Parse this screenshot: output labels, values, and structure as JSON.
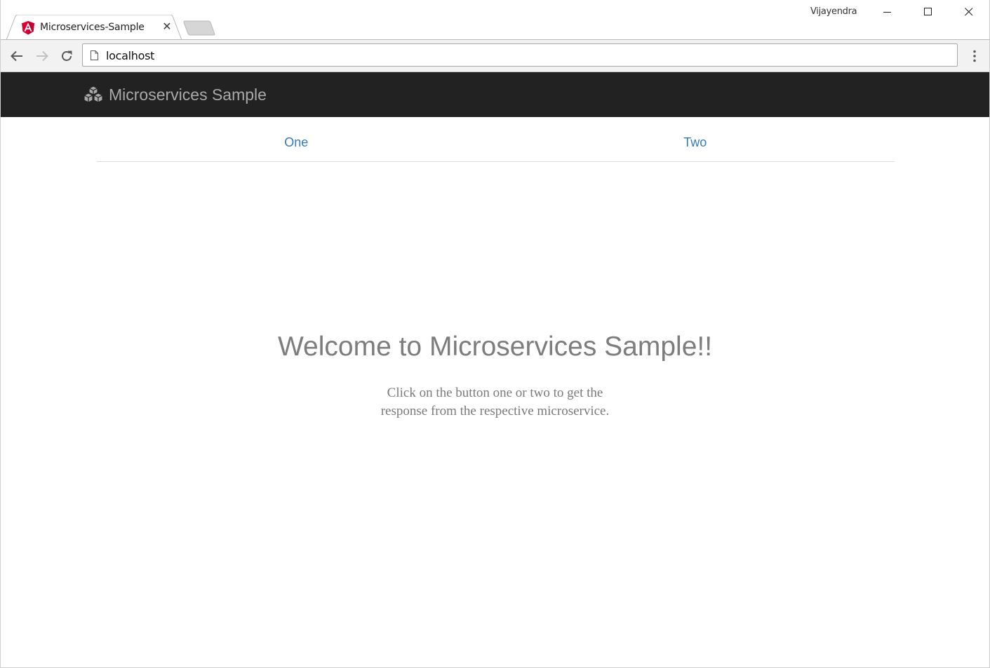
{
  "browser": {
    "tab": {
      "title": "Microservices-Sample",
      "close_glyph": "✕",
      "favicon": "angular-logo-icon"
    },
    "profile_name": "Vijayendra",
    "url": "localhost",
    "icons": {
      "back": "arrow-left-icon",
      "forward": "arrow-right-icon",
      "reload": "reload-icon",
      "page": "page-icon",
      "menu": "kebab-menu-icon",
      "minimize": "minimize-icon",
      "maximize": "maximize-icon",
      "close": "close-icon"
    }
  },
  "app": {
    "brand": {
      "name": "Microservices Sample",
      "icon": "cubes-icon"
    },
    "nav": {
      "one": "One",
      "two": "Two"
    },
    "hero": {
      "title": "Welcome to Microservices Sample!!",
      "text": "Click on the button one or two to get the response from the respective microservice."
    }
  },
  "colors": {
    "navbar_bg": "#222222",
    "brand_text": "#a9a9a9",
    "link": "#337ab7",
    "hero_text": "#7d7d7d",
    "angular_red": "#dd0031"
  }
}
